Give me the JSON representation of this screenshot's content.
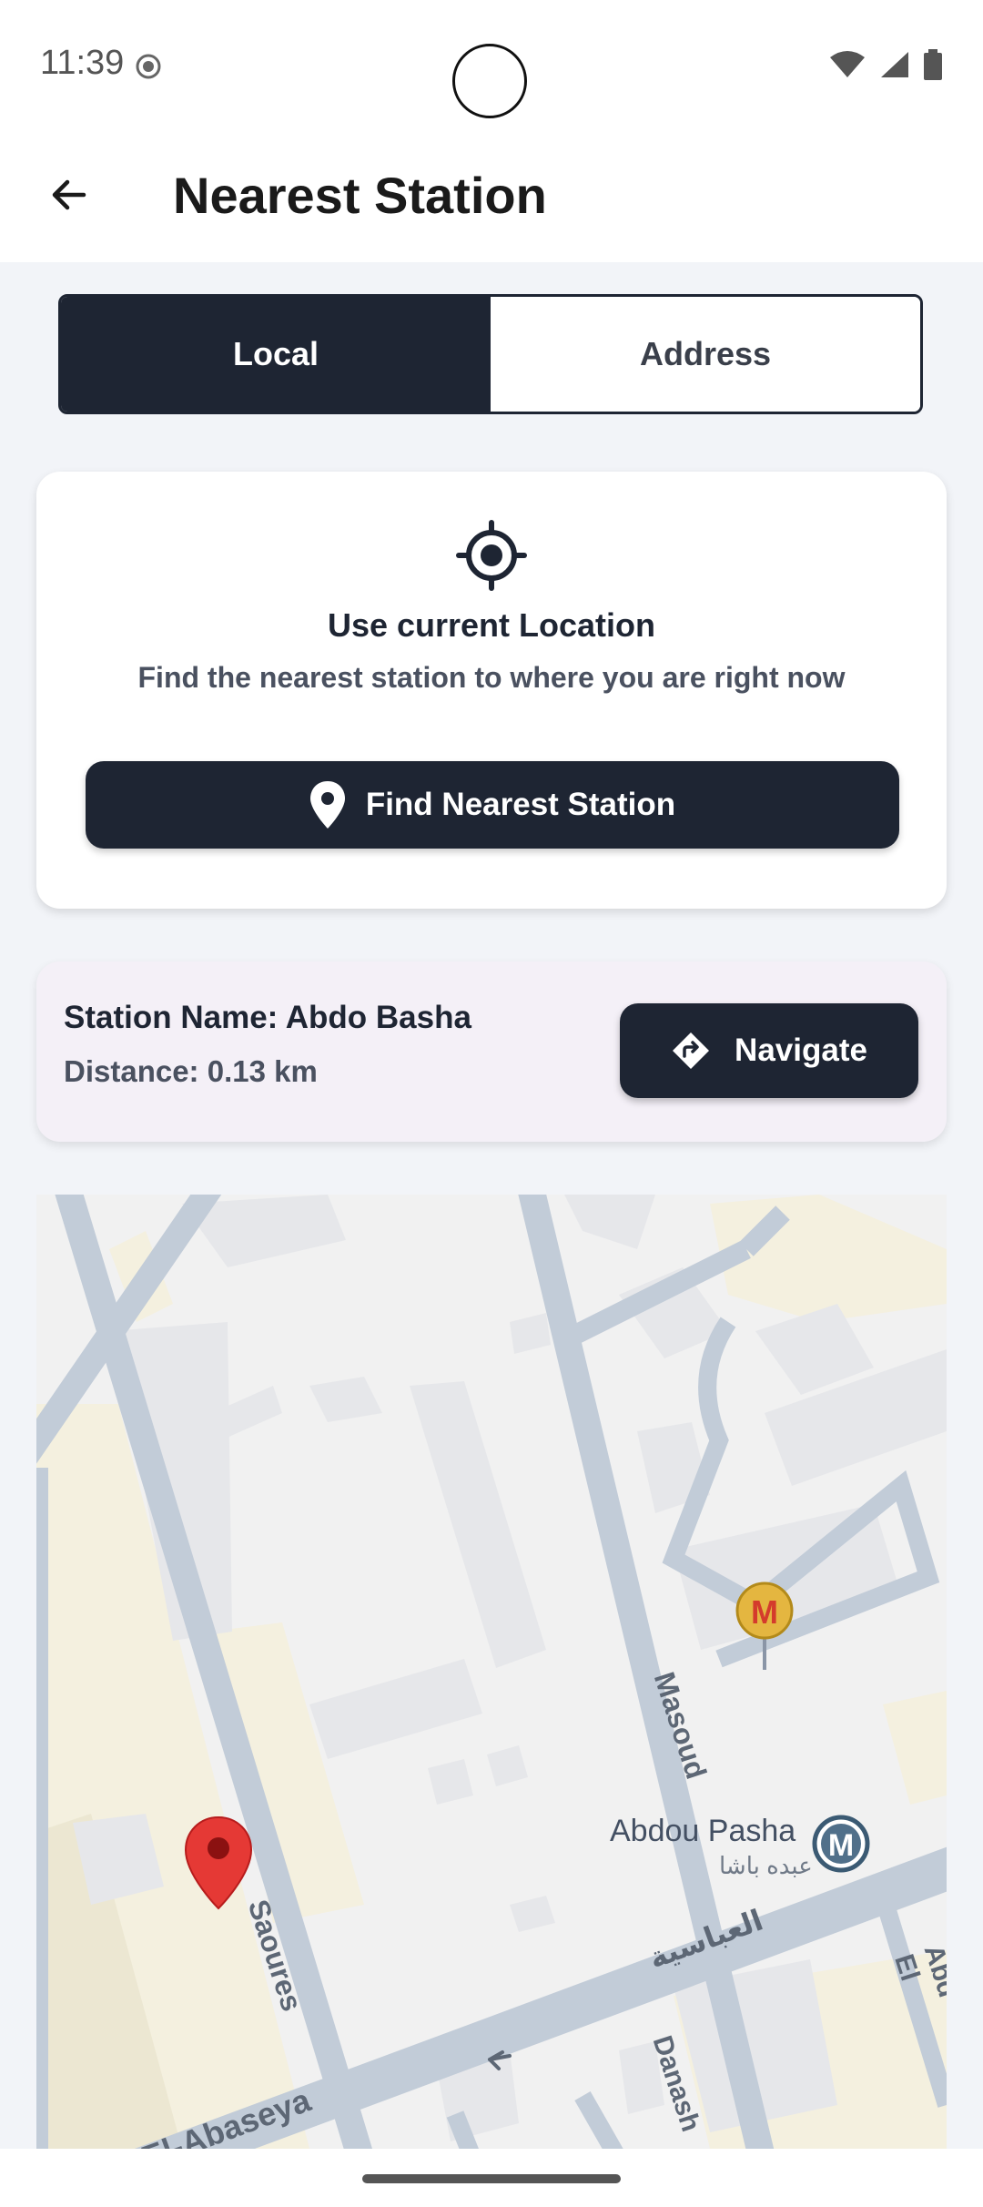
{
  "status": {
    "time": "11:39",
    "icons": [
      "recording-icon",
      "wifi-icon",
      "signal-icon",
      "battery-icon"
    ]
  },
  "header": {
    "title": "Nearest Station",
    "back_icon": "arrow-left-icon"
  },
  "segment": {
    "local_label": "Local",
    "address_label": "Address",
    "selected": "Local"
  },
  "location_card": {
    "icon": "crosshair-target-icon",
    "title": "Use current Location",
    "subtitle": "Find the nearest station to where you are right now",
    "button_label": "Find Nearest Station",
    "button_icon": "location-pin-icon"
  },
  "result": {
    "name_label": "Station Name:",
    "name_value": "Abdo Basha",
    "distance_label": "Distance:",
    "distance_value": "0.13 km",
    "navigate_label": "Navigate",
    "navigate_icon": "directions-icon"
  },
  "map": {
    "labels": {
      "masoud": "Masoud",
      "saoures": "Saoures",
      "abdou_pasha_en": "Abdou Pasha",
      "abdou_pasha_ar": "عبده باشا",
      "abbasiya_ar": "العباسية",
      "danash": "Danash",
      "abd_el": "Abd El",
      "el_abaseya": "El-Abaseya"
    },
    "colors": {
      "road": "#c2ccd8",
      "building": "#e6e7ea",
      "building_warm": "#f4f0df",
      "pin": "#e53935",
      "metro_badge": "#e4b640"
    }
  },
  "colors": {
    "primary": "#1e2533",
    "background": "#f2f4f8",
    "result_bg": "#f4f0f7"
  }
}
